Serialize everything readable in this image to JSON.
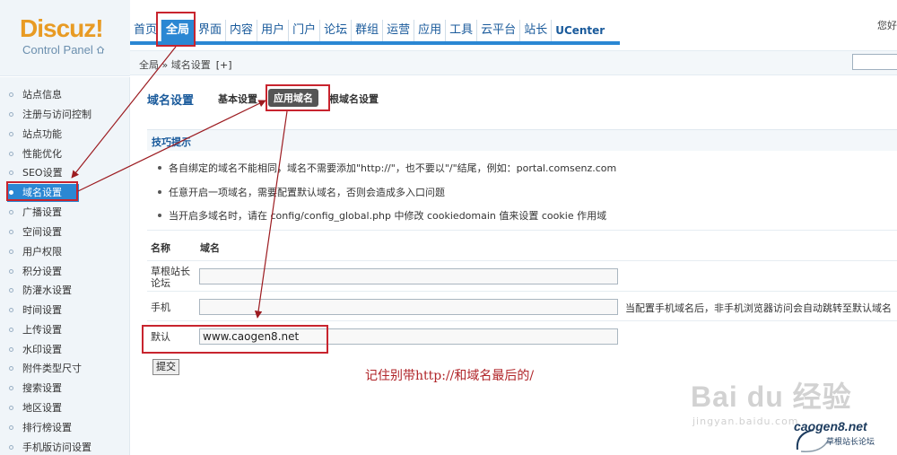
{
  "logo": {
    "main": "Discuz!",
    "sub": "Control Panel"
  },
  "topnav": [
    {
      "label": "首页",
      "active": false
    },
    {
      "label": "全局",
      "active": true
    },
    {
      "label": "界面",
      "active": false
    },
    {
      "label": "内容",
      "active": false
    },
    {
      "label": "用户",
      "active": false
    },
    {
      "label": "门户",
      "active": false
    },
    {
      "label": "论坛",
      "active": false
    },
    {
      "label": "群组",
      "active": false
    },
    {
      "label": "运营",
      "active": false
    },
    {
      "label": "应用",
      "active": false
    },
    {
      "label": "工具",
      "active": false
    },
    {
      "label": "云平台",
      "active": false
    },
    {
      "label": "站长",
      "active": false
    },
    {
      "label": "UCenter",
      "active": false
    }
  ],
  "user_greeting": "您好",
  "breadcrumb": {
    "text": "全局 » 域名设置",
    "plus": "[+]"
  },
  "sidebar": [
    {
      "label": "站点信息"
    },
    {
      "label": "注册与访问控制"
    },
    {
      "label": "站点功能"
    },
    {
      "label": "性能优化"
    },
    {
      "label": "SEO设置"
    },
    {
      "label": "域名设置",
      "active": true
    },
    {
      "label": "广播设置"
    },
    {
      "label": "空间设置"
    },
    {
      "label": "用户权限"
    },
    {
      "label": "积分设置"
    },
    {
      "label": "防灌水设置"
    },
    {
      "label": "时间设置"
    },
    {
      "label": "上传设置"
    },
    {
      "label": "水印设置"
    },
    {
      "label": "附件类型尺寸"
    },
    {
      "label": "搜索设置"
    },
    {
      "label": "地区设置"
    },
    {
      "label": "排行榜设置"
    },
    {
      "label": "手机版访问设置"
    }
  ],
  "main": {
    "title": "域名设置",
    "subtabs": [
      {
        "label": "基本设置",
        "active": false
      },
      {
        "label": "应用域名",
        "active": true
      },
      {
        "label": "根域名设置",
        "active": false
      }
    ],
    "tips_title": "技巧提示",
    "tips": [
      "各自绑定的域名不能相同，域名不需要添加\"http://\"，也不要以\"/\"结尾，例如：portal.comsenz.com",
      "任意开启一项域名，需要配置默认域名，否则会造成多入口问题",
      "当开启多域名时，请在 config/config_global.php 中修改 cookiedomain 值来设置 cookie 作用域"
    ],
    "table": {
      "col_name": "名称",
      "col_domain": "域名",
      "rows": [
        {
          "label": "草根站长论坛",
          "value": "",
          "note": ""
        },
        {
          "label": "手机",
          "value": "",
          "note": "当配置手机域名后，非手机浏览器访问会自动跳转至默认域名"
        },
        {
          "label": "默认",
          "value": "www.caogen8.net",
          "note": ""
        }
      ]
    },
    "submit_label": "提交",
    "annotation": "记住别带http://和域名最后的/"
  },
  "watermark": {
    "main": "Bai du 经验",
    "sub": "jingyan.baidu.com"
  },
  "brand": {
    "main": "caogen8.net",
    "sub": "草根站长论坛"
  },
  "colors": {
    "accent": "#2b87d3",
    "highlight": "#c8242e",
    "annotation": "#b02428"
  }
}
